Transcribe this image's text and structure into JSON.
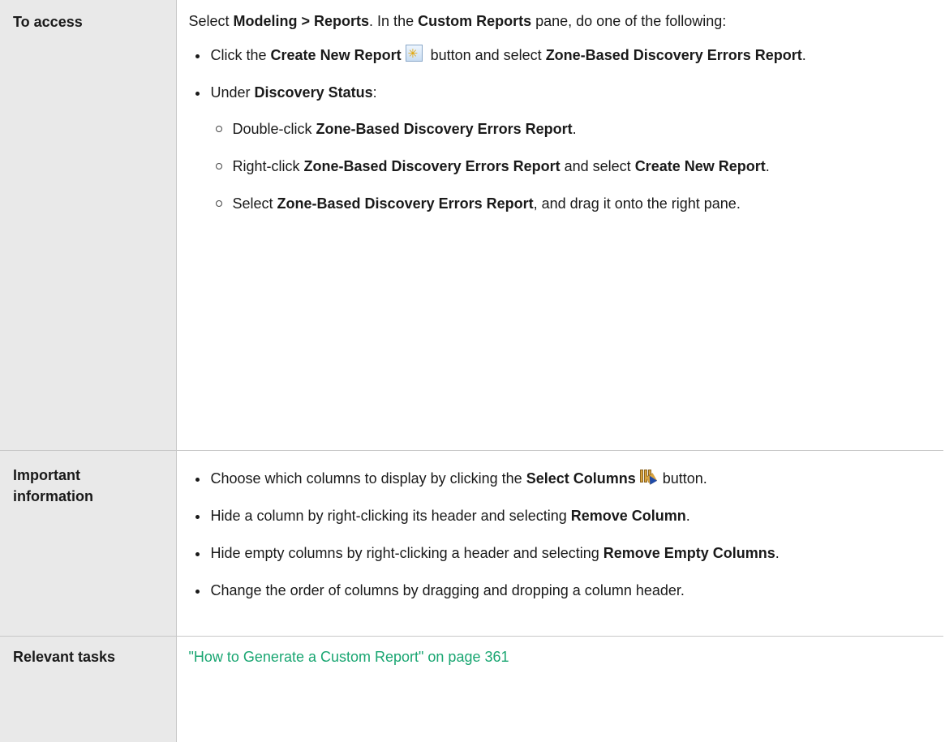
{
  "rows": {
    "access": {
      "header": "To access",
      "intro": {
        "t1": "Select ",
        "b1": "Modeling > Reports",
        "t2": ". In the ",
        "b2": "Custom Reports",
        "t3": " pane, do one of the following:"
      },
      "bullet1": {
        "t1": "Click the ",
        "b1": "Create New Report",
        "t2": " button and select ",
        "b2": "Zone-Based Discovery Errors Report",
        "t3": "."
      },
      "bullet2": {
        "t1": "Under ",
        "b1": "Discovery Status",
        "t2": ":"
      },
      "sub1": {
        "t1": "Double-click ",
        "b1": "Zone-Based Discovery Errors Report",
        "t2": "."
      },
      "sub2": {
        "t1": "Right-click ",
        "b1": "Zone-Based Discovery Errors Report",
        "t2": " and select ",
        "b2": "Create New Report",
        "t3": "."
      },
      "sub3": {
        "t1": "Select ",
        "b1": "Zone-Based Discovery Errors Report",
        "t2": ", and drag it onto the right pane."
      }
    },
    "important": {
      "header": "Important information",
      "b1": {
        "t1": "Choose which columns to display by clicking the ",
        "b1": "Select Columns",
        "t2": " button."
      },
      "b2": {
        "t1": "Hide a column by right-clicking its header and selecting ",
        "b1": "Remove Column",
        "t2": "."
      },
      "b3": {
        "t1": "Hide empty columns by right-clicking a header and selecting ",
        "b1": "Remove Empty Columns",
        "t2": "."
      },
      "b4": {
        "t1": "Change the order of columns by dragging and dropping a column header."
      }
    },
    "tasks": {
      "header": "Relevant tasks",
      "link": "\"How to Generate a Custom Report\" on page 361"
    }
  },
  "icons": {
    "create_new_report": "create-new-report-icon",
    "select_columns": "select-columns-icon"
  },
  "colors": {
    "link": "#1aa672",
    "header_bg": "#e9e9e9"
  }
}
